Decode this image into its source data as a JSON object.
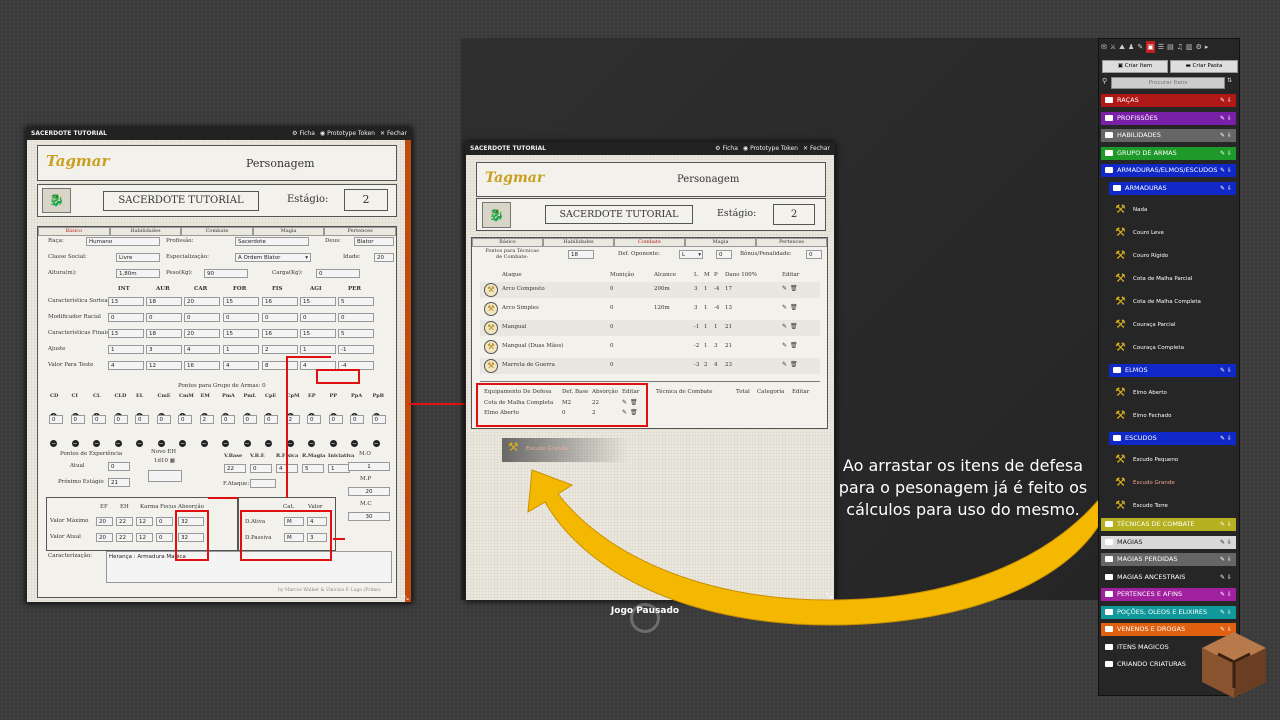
{
  "left_window": {
    "title": "SACERDOTE TUTORIAL",
    "btn_sheet": "Ficha",
    "btn_token": "Prototype Token",
    "btn_close": "Fechar",
    "logo": "Tagmar",
    "header": "Personagem",
    "char_name": "SACERDOTE TUTORIAL",
    "stage_label": "Estágio:",
    "stage_value": "2",
    "tabs": [
      "Básico",
      "Habilidades",
      "Combate",
      "Magia",
      "Pertences"
    ],
    "raca_label": "Raça:",
    "raca": "Humano",
    "profissao_label": "Profissão:",
    "profissao": "Sacerdote",
    "deus_label": "Deus:",
    "deus": "Blator",
    "classe_label": "Classe Social:",
    "classe": "Livre",
    "espec_label": "Especialização:",
    "espec": "A Ordem Blator",
    "idade_label": "Idade:",
    "idade": "20",
    "altura_label": "Altura(m):",
    "altura": "1,80m",
    "peso_label": "Peso(Kg):",
    "peso": "90",
    "carga_label": "Carga(Kg):",
    "carga": "0",
    "attr_headers": [
      "INT",
      "AUR",
      "CAR",
      "FOR",
      "FIS",
      "AGI",
      "PER"
    ],
    "attr_rows": [
      {
        "label": "Característica Sorteada",
        "values": [
          "13",
          "18",
          "20",
          "15",
          "16",
          "15",
          "5"
        ]
      },
      {
        "label": "Modificador Racial",
        "values": [
          "0",
          "0",
          "0",
          "0",
          "0",
          "0",
          "0"
        ]
      },
      {
        "label": "Características Finais",
        "values": [
          "13",
          "18",
          "20",
          "15",
          "16",
          "15",
          "5"
        ]
      },
      {
        "label": "Ajuste",
        "values": [
          "1",
          "3",
          "4",
          "1",
          "2",
          "1",
          "-1"
        ]
      },
      {
        "label": "Valor Para Teste",
        "values": [
          "4",
          "12",
          "16",
          "4",
          "8",
          "4",
          "-4"
        ]
      }
    ],
    "weapon_points": "Pontos para Grupo de Armas: 0",
    "weapon_groups": [
      "CD",
      "CI",
      "CL",
      "CLD",
      "EL",
      "CmE",
      "CmM",
      "EM",
      "PmA",
      "PmL",
      "CpE",
      "CpM",
      "EP",
      "PP",
      "PpA",
      "PpB"
    ],
    "weapon_values": [
      "0",
      "0",
      "0",
      "0",
      "0",
      "0",
      "0",
      "2",
      "0",
      "0",
      "0",
      "2",
      "0",
      "0",
      "0",
      "0"
    ],
    "exp_label": "Pontos de Experiência",
    "atual_label": "Atual",
    "atual": "0",
    "proximo_label": "Próximo Estágio",
    "proximo": "21",
    "novo_eh_label": "Novo EH",
    "novo_eh": "1d10",
    "combat_headers": [
      "V.Base",
      "V.B.E",
      "R.Física",
      "R.Magia",
      "Iniciativa"
    ],
    "combat_values": [
      "22",
      "0",
      "4",
      "5",
      "1"
    ],
    "fataque_label": "F.Ataque:",
    "mo_label": "M.O",
    "mo": "1",
    "mp_label": "M.P",
    "mp": "20",
    "mc_label": "M.C",
    "mc": "30",
    "ef_headers": [
      "EF",
      "EH",
      "Karma",
      "Focus",
      "Absorção"
    ],
    "valor_max_label": "Valor Máximo",
    "valor_max": [
      "20",
      "22",
      "12",
      "0",
      "32"
    ],
    "valor_atual_label": "Valor Atual",
    "valor_atual": [
      "20",
      "22",
      "12",
      "0",
      "32"
    ],
    "def_headers": [
      "Cat.",
      "Valor"
    ],
    "def_ativa_label": "D.Ativa",
    "def_ativa": [
      "M",
      "4"
    ],
    "def_passiva_label": "D.Passiva",
    "def_passiva": [
      "M",
      "3"
    ],
    "caract_label": "Caracterização:",
    "caract_text": "Herança : Armadura Magica",
    "credits": "by Marcos Walker & Vinícius F. Lago (Prime)"
  },
  "mid_window": {
    "title": "SACERDOTE TUTORIAL",
    "btn_sheet": "Ficha",
    "btn_token": "Prototype Token",
    "btn_close": "Fechar",
    "logo": "Tagmar",
    "header": "Personagem",
    "char_name": "SACERDOTE TUTORIAL",
    "stage_label": "Estágio:",
    "stage_value": "2",
    "tabs": [
      "Básico",
      "Habilidades",
      "Combate",
      "Magia",
      "Pertences"
    ],
    "tec_label": "Pontos para Técnicas de Combate:",
    "tec": "18",
    "def_op_label": "Def. Oponente:",
    "def_op": "L",
    "def_op_val": "0",
    "bonus_label": "Bônus/Penalidade:",
    "bonus": "0",
    "attack_headers": [
      "Ataque",
      "Munição",
      "Alcance",
      "L",
      "M",
      "P",
      "Dano 100%",
      "Editar"
    ],
    "attacks": [
      {
        "name": "Arco Composto",
        "mun": "0",
        "alc": "200m",
        "l": "3",
        "m": "1",
        "p": "-4",
        "d": "17"
      },
      {
        "name": "Arco Simples",
        "mun": "0",
        "alc": "120m",
        "l": "3",
        "m": "1",
        "p": "-4",
        "d": "13"
      },
      {
        "name": "Mangual",
        "mun": "0",
        "alc": "",
        "l": "-1",
        "m": "1",
        "p": "1",
        "d": "21"
      },
      {
        "name": "Mangual (Duas Mãos)",
        "mun": "0",
        "alc": "",
        "l": "-2",
        "m": "1",
        "p": "3",
        "d": "21"
      },
      {
        "name": "Marreta de Guerra",
        "mun": "0",
        "alc": "",
        "l": "-3",
        "m": "2",
        "p": "4",
        "d": "23"
      }
    ],
    "eq_headers": [
      "Equipamento De Defesa",
      "Def. Base",
      "Absorção",
      "Editar"
    ],
    "equipment": [
      {
        "name": "Cota de Malha Completa",
        "def": "M2",
        "abs": "22"
      },
      {
        "name": "Elmo Aberto",
        "def": "0",
        "abs": "2"
      }
    ],
    "tech_headers": [
      "Técnica de Combate",
      "Total",
      "Categoria",
      "Editar"
    ]
  },
  "drag_ghost": "Escudo Grande",
  "paused_text": "Jogo Pausado",
  "overlay_text": "Ao arrastar os itens de defesa para o pesonagem já é feito os cálculos para uso do mesmo.",
  "sidebar": {
    "create_item": "Criar Item",
    "create_folder": "Criar Pasta",
    "search_placeholder": "Procurar Itens",
    "folders": [
      {
        "label": "RAÇAS",
        "color": "#b01818"
      },
      {
        "label": "PROFISSÕES",
        "color": "#7a1fa8"
      },
      {
        "label": "HABILIDADES",
        "color": "#666666"
      },
      {
        "label": "GRUPO DE ARMAS",
        "color": "#1e9a2a"
      },
      {
        "label": "ARMADURAS/ELMOS/ESCUDOS",
        "color": "#1028c8"
      }
    ],
    "sub_armaduras": "ARMADURAS",
    "armaduras": [
      "Nada",
      "Couro Leve",
      "Couro Rígido",
      "Cota de Malha Parcial",
      "Cota de Malha Completa",
      "Couraça Parcial",
      "Couraça Completa"
    ],
    "sub_elmos": "ELMOS",
    "elmos": [
      "Elmo Aberto",
      "Elmo Fechado"
    ],
    "sub_escudos": "ESCUDOS",
    "escudos": [
      "Escudo Pequeno",
      "Escudo Grande",
      "Escudo Torre"
    ],
    "folders2": [
      {
        "label": "TÉCNICAS DE COMBATE",
        "color": "#b5b020"
      },
      {
        "label": "MAGIAS",
        "color": "#d8d8d8"
      },
      {
        "label": "MAGIAS PERDIDAS",
        "color": "#666666"
      },
      {
        "label": "MAGIAS ANCESTRAIS",
        "color": "#262626"
      },
      {
        "label": "PERTENCES E AFINS",
        "color": "#a020a0"
      },
      {
        "label": "POÇÕES, OLEOS E ELIXIRES",
        "color": "#10989a"
      },
      {
        "label": "VENENOS E DROGAS",
        "color": "#e06010"
      },
      {
        "label": "ITENS MAGICOS",
        "color": "#262626"
      },
      {
        "label": "CRIANDO CRIATURAS",
        "color": "#262626"
      }
    ]
  }
}
